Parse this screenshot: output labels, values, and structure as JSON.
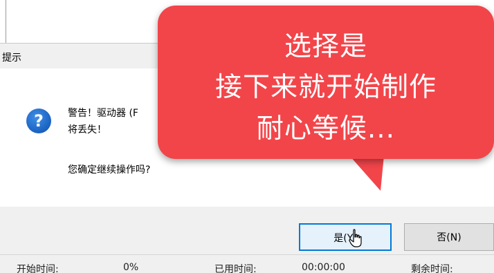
{
  "dialog": {
    "title": "提示",
    "icon": "question-icon",
    "message_line1": "警告！驱动器 (F",
    "message_line2": "将丢失！",
    "question": "您确定继续操作吗?",
    "yes_label": "是(Y)",
    "no_label": "否(N)"
  },
  "annotation": {
    "line1": "选择是",
    "line2": "接下来就开始制作",
    "line3": "耐心等候..."
  },
  "background_status": {
    "field1": "开始时间:",
    "field1_value": "0%",
    "field2": "已用时间:",
    "field2_value": "00:00:00",
    "field3": "剩余时间:"
  },
  "colors": {
    "callout": "#f2454a",
    "dialog_bg": "#f0f0f0",
    "focus_border": "#0078d7",
    "icon_blue": "#1e67c7"
  },
  "cursor": "hand-pointer-icon"
}
